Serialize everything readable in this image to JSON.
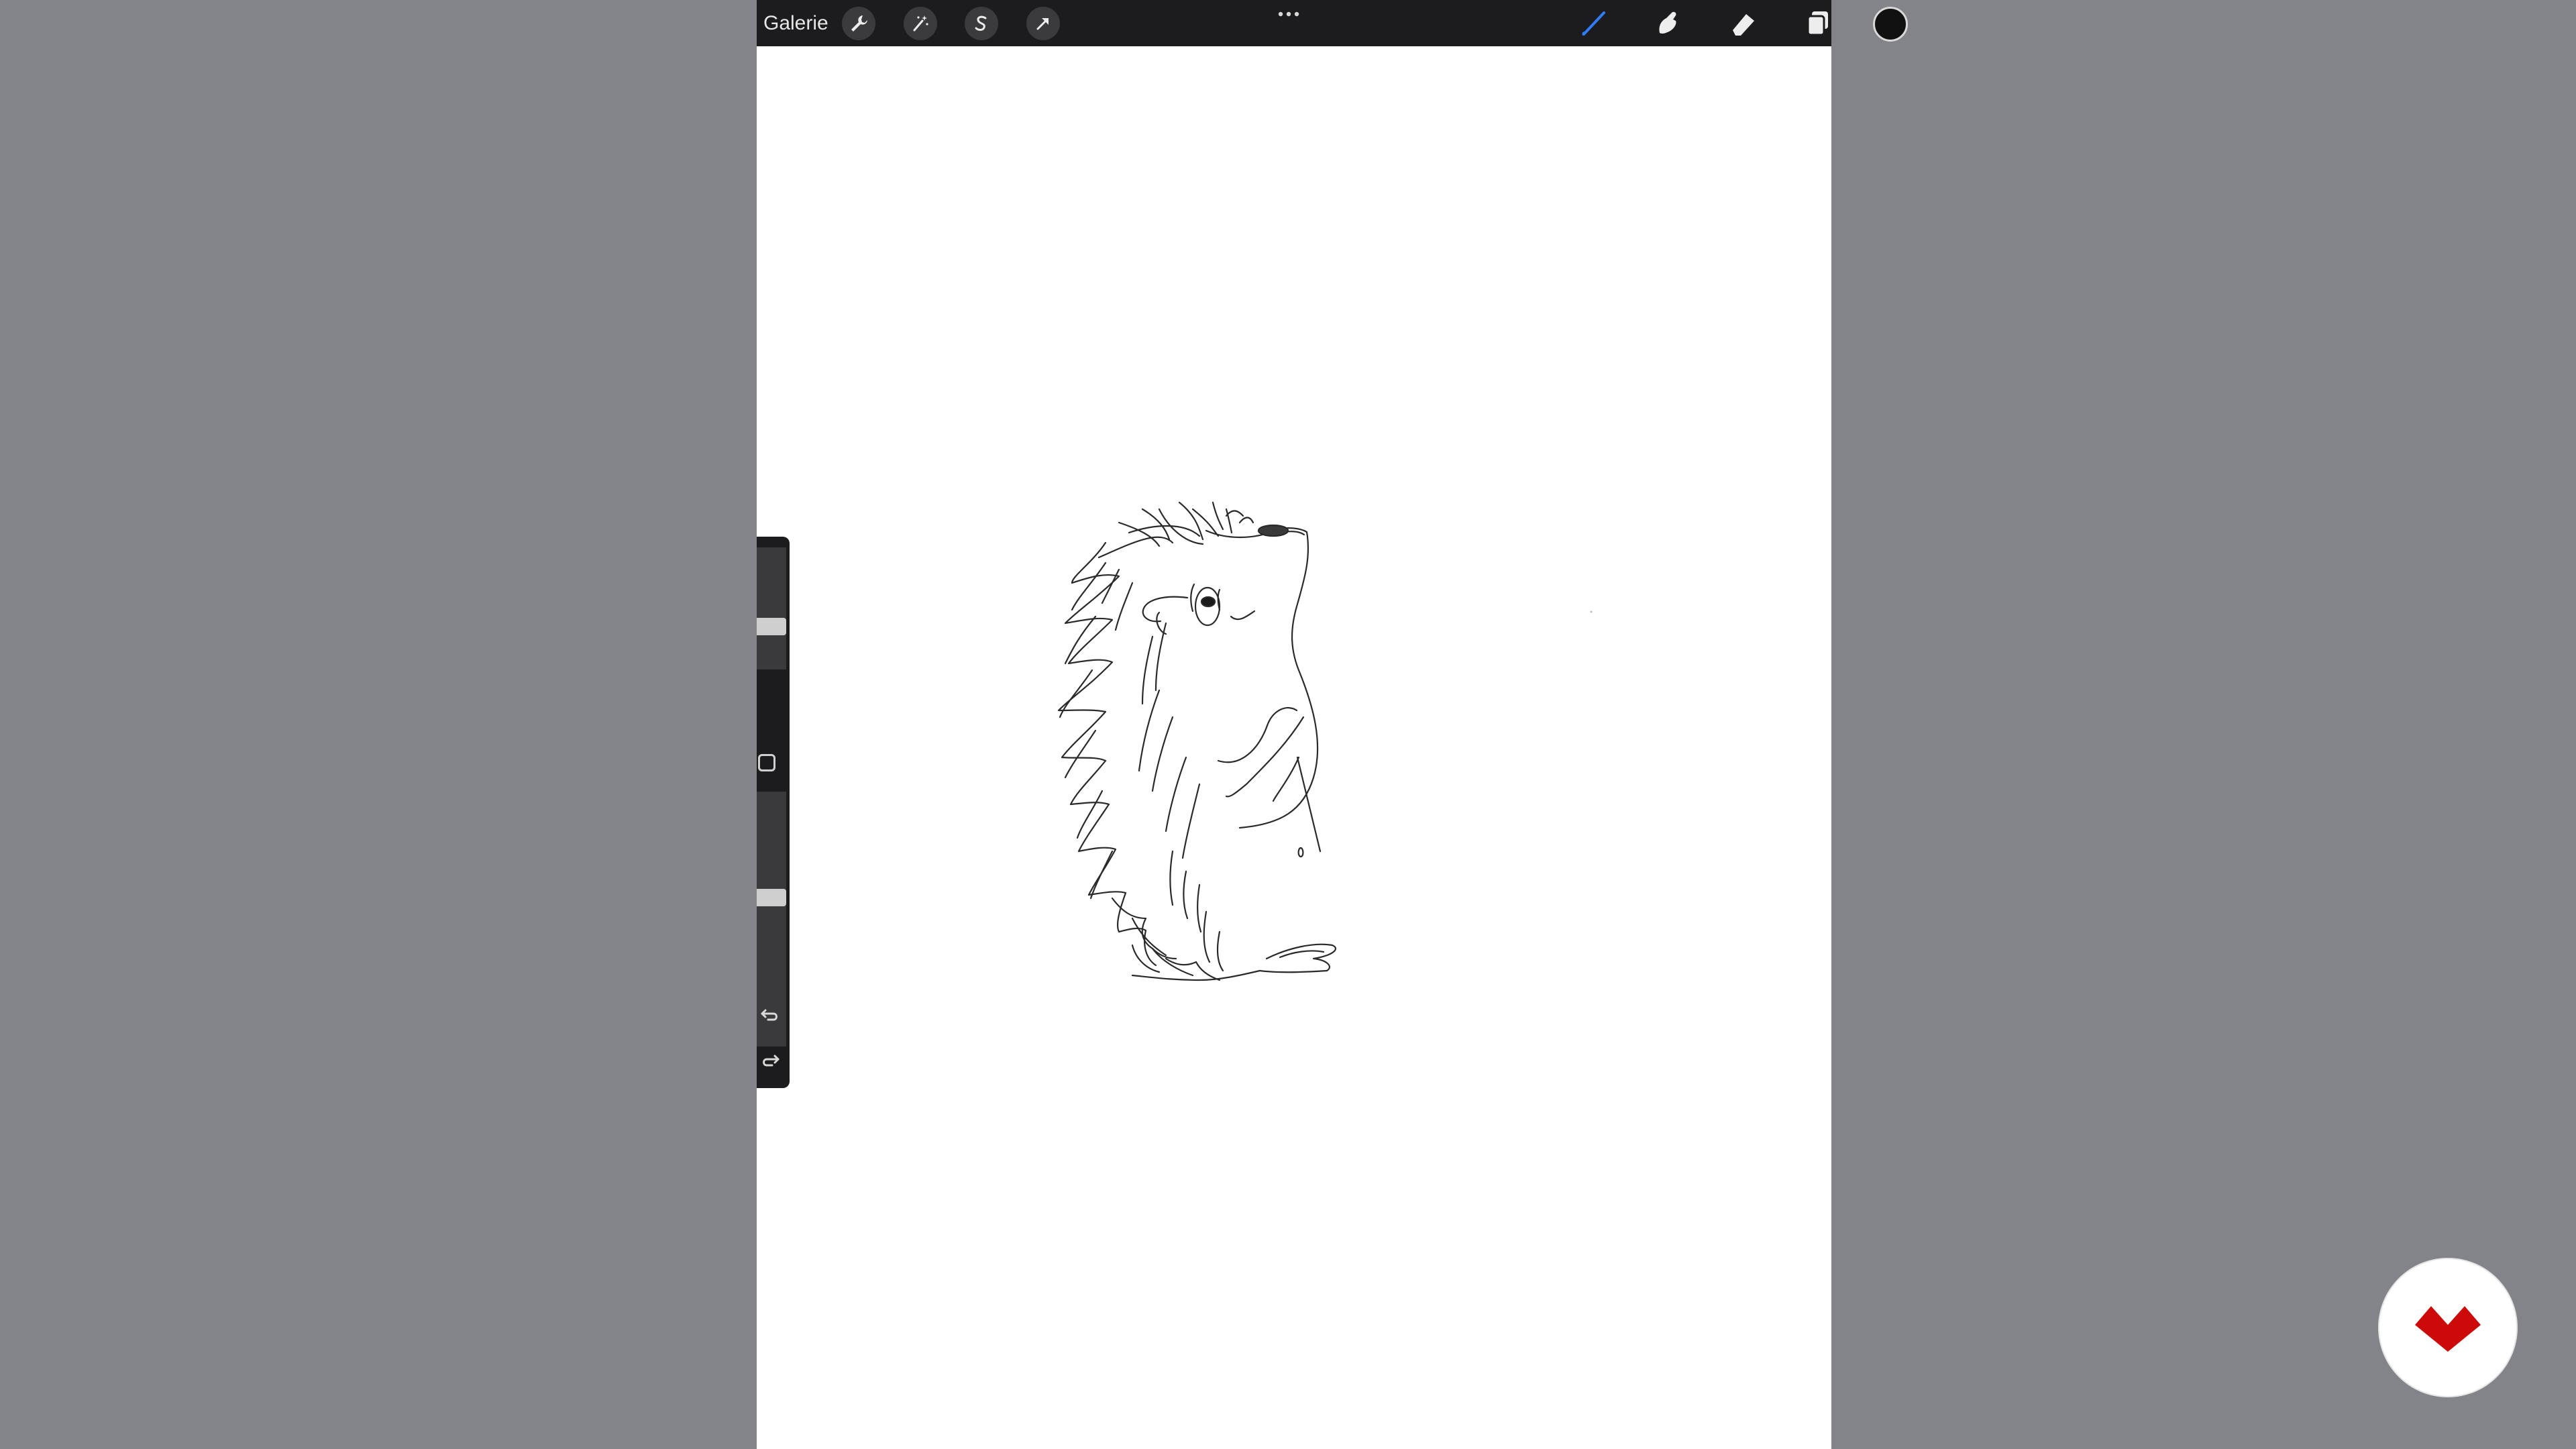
{
  "toolbar": {
    "gallery_label": "Galerie",
    "left_tools": [
      "wrench-icon",
      "magic-wand-icon",
      "s-selection-icon",
      "arrow-transform-icon"
    ],
    "more_icon": "ellipsis-icon",
    "right_tools": [
      "brush-icon",
      "smudge-icon",
      "eraser-icon",
      "layers-icon"
    ],
    "active_tool": "brush",
    "accent_color": "#2f7cf6",
    "current_color": "#111111"
  },
  "sidebar": {
    "brush_size_fraction": 0.33,
    "opacity_fraction": 0.59,
    "modify_icon": "square-modify-icon",
    "undo_icon": "undo-icon",
    "redo_icon": "redo-icon"
  },
  "canvas": {
    "background": "#ffffff",
    "stroke_color": "#2a2a2a",
    "drawing": "hedgehog-sketch"
  },
  "watermark": {
    "icon": "brand-logo-icon",
    "brand_color": "#cc0a0a"
  }
}
